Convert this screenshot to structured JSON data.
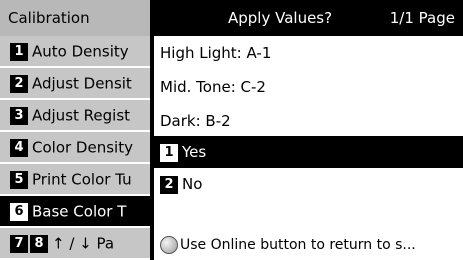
{
  "menu": {
    "title": "Calibration",
    "items": [
      {
        "num": "1",
        "label": "Auto Density"
      },
      {
        "num": "2",
        "label": "Adjust Densit"
      },
      {
        "num": "3",
        "label": "Adjust Regist"
      },
      {
        "num": "4",
        "label": "Color Density"
      },
      {
        "num": "5",
        "label": "Print Color Tu"
      },
      {
        "num": "6",
        "label": "Base Color T"
      }
    ],
    "pager": {
      "num1": "7",
      "num2": "8",
      "label": "↑ / ↓ Pa"
    }
  },
  "dialog": {
    "title": "Apply Values?",
    "page": "1/1 Page",
    "values": [
      "High Light: A-1",
      "Mid. Tone: C-2",
      "Dark: B-2"
    ],
    "options": [
      {
        "num": "1",
        "label": "Yes"
      },
      {
        "num": "2",
        "label": "No"
      }
    ],
    "footer": "Use Online button to return to s..."
  }
}
